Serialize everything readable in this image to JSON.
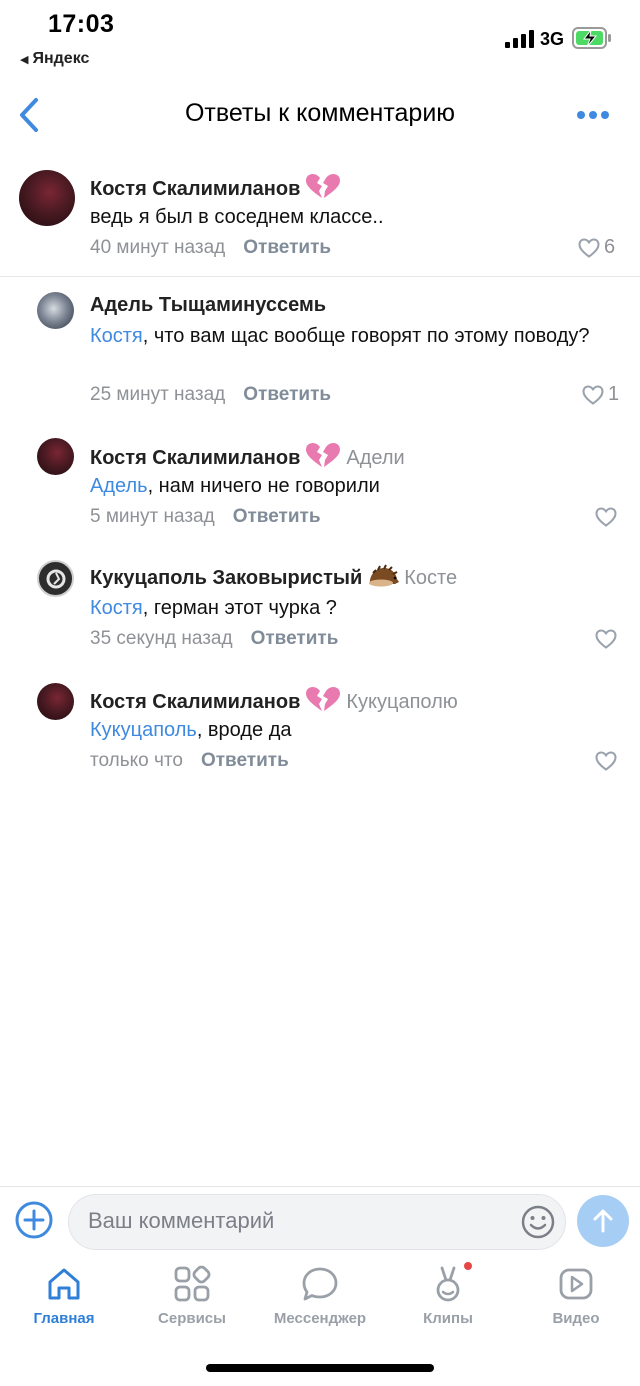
{
  "status_bar": {
    "time": "17:03",
    "back_app": "Яндекс",
    "network": "3G"
  },
  "header": {
    "title": "Ответы к комментарию"
  },
  "colors": {
    "accent": "#3f8ae0",
    "muted": "#8e9196",
    "send_bg": "#a6cdf3"
  },
  "comments": [
    {
      "author": "Костя Скалимиланов",
      "emoji": "broken-heart",
      "reply_to": "",
      "mention": "",
      "text": "ведь я был в соседнем классе..",
      "time": "40 минут назад",
      "reply_label": "Ответить",
      "likes": "6"
    },
    {
      "author": "Адель Тыщаминуссемь",
      "emoji": "",
      "reply_to": "",
      "mention": "Костя",
      "text": ", что вам щас вообще говорят по этому поводу?",
      "time": "25 минут назад",
      "reply_label": "Ответить",
      "likes": "1"
    },
    {
      "author": "Костя Скалимиланов",
      "emoji": "broken-heart",
      "reply_to": "Адели",
      "mention": "Адель",
      "text": ", нам ничего не говорили",
      "time": "5 минут назад",
      "reply_label": "Ответить",
      "likes": ""
    },
    {
      "author": "Кукуцаполь Заковыристый",
      "emoji": "hedgehog",
      "reply_to": "Косте",
      "mention": "Костя",
      "text": ", герман этот чурка ?",
      "time": "35 секунд назад",
      "reply_label": "Ответить",
      "likes": ""
    },
    {
      "author": "Костя Скалимиланов",
      "emoji": "broken-heart",
      "reply_to": "Кукуцаполю",
      "mention": "Кукуцаполь",
      "text": ", вроде да",
      "time": "только что",
      "reply_label": "Ответить",
      "likes": ""
    }
  ],
  "composer": {
    "placeholder": "Ваш комментарий"
  },
  "tabbar": {
    "items": [
      {
        "label": "Главная",
        "icon": "home-icon",
        "active": true
      },
      {
        "label": "Сервисы",
        "icon": "services-icon",
        "active": false
      },
      {
        "label": "Мессенджер",
        "icon": "chat-icon",
        "active": false
      },
      {
        "label": "Клипы",
        "icon": "clips-icon",
        "active": false
      },
      {
        "label": "Видео",
        "icon": "video-icon",
        "active": false
      }
    ]
  }
}
